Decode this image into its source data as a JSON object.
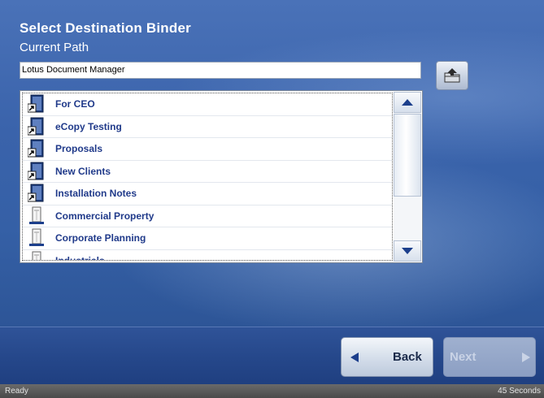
{
  "header": {
    "title": "Select Destination Binder",
    "subtitle": "Current Path"
  },
  "path": {
    "value": "Lotus Document Manager"
  },
  "up_button": {
    "icon": "folder-up-icon"
  },
  "list": {
    "items": [
      {
        "label": "For CEO",
        "icon": "binder-shortcut-icon"
      },
      {
        "label": "eCopy Testing",
        "icon": "binder-shortcut-icon"
      },
      {
        "label": "Proposals",
        "icon": "binder-shortcut-icon"
      },
      {
        "label": "New Clients",
        "icon": "binder-shortcut-icon"
      },
      {
        "label": "Installation Notes",
        "icon": "binder-shortcut-icon"
      },
      {
        "label": "Commercial Property",
        "icon": "binder-icon"
      },
      {
        "label": "Corporate Planning",
        "icon": "binder-icon"
      },
      {
        "label": "Industrials",
        "icon": "binder-icon"
      }
    ]
  },
  "footer": {
    "back_label": "Back",
    "next_label": "Next"
  },
  "status": {
    "left": "Ready",
    "right": "45 Seconds"
  },
  "colors": {
    "accent": "#3a63ab",
    "item_text": "#203a8a"
  }
}
